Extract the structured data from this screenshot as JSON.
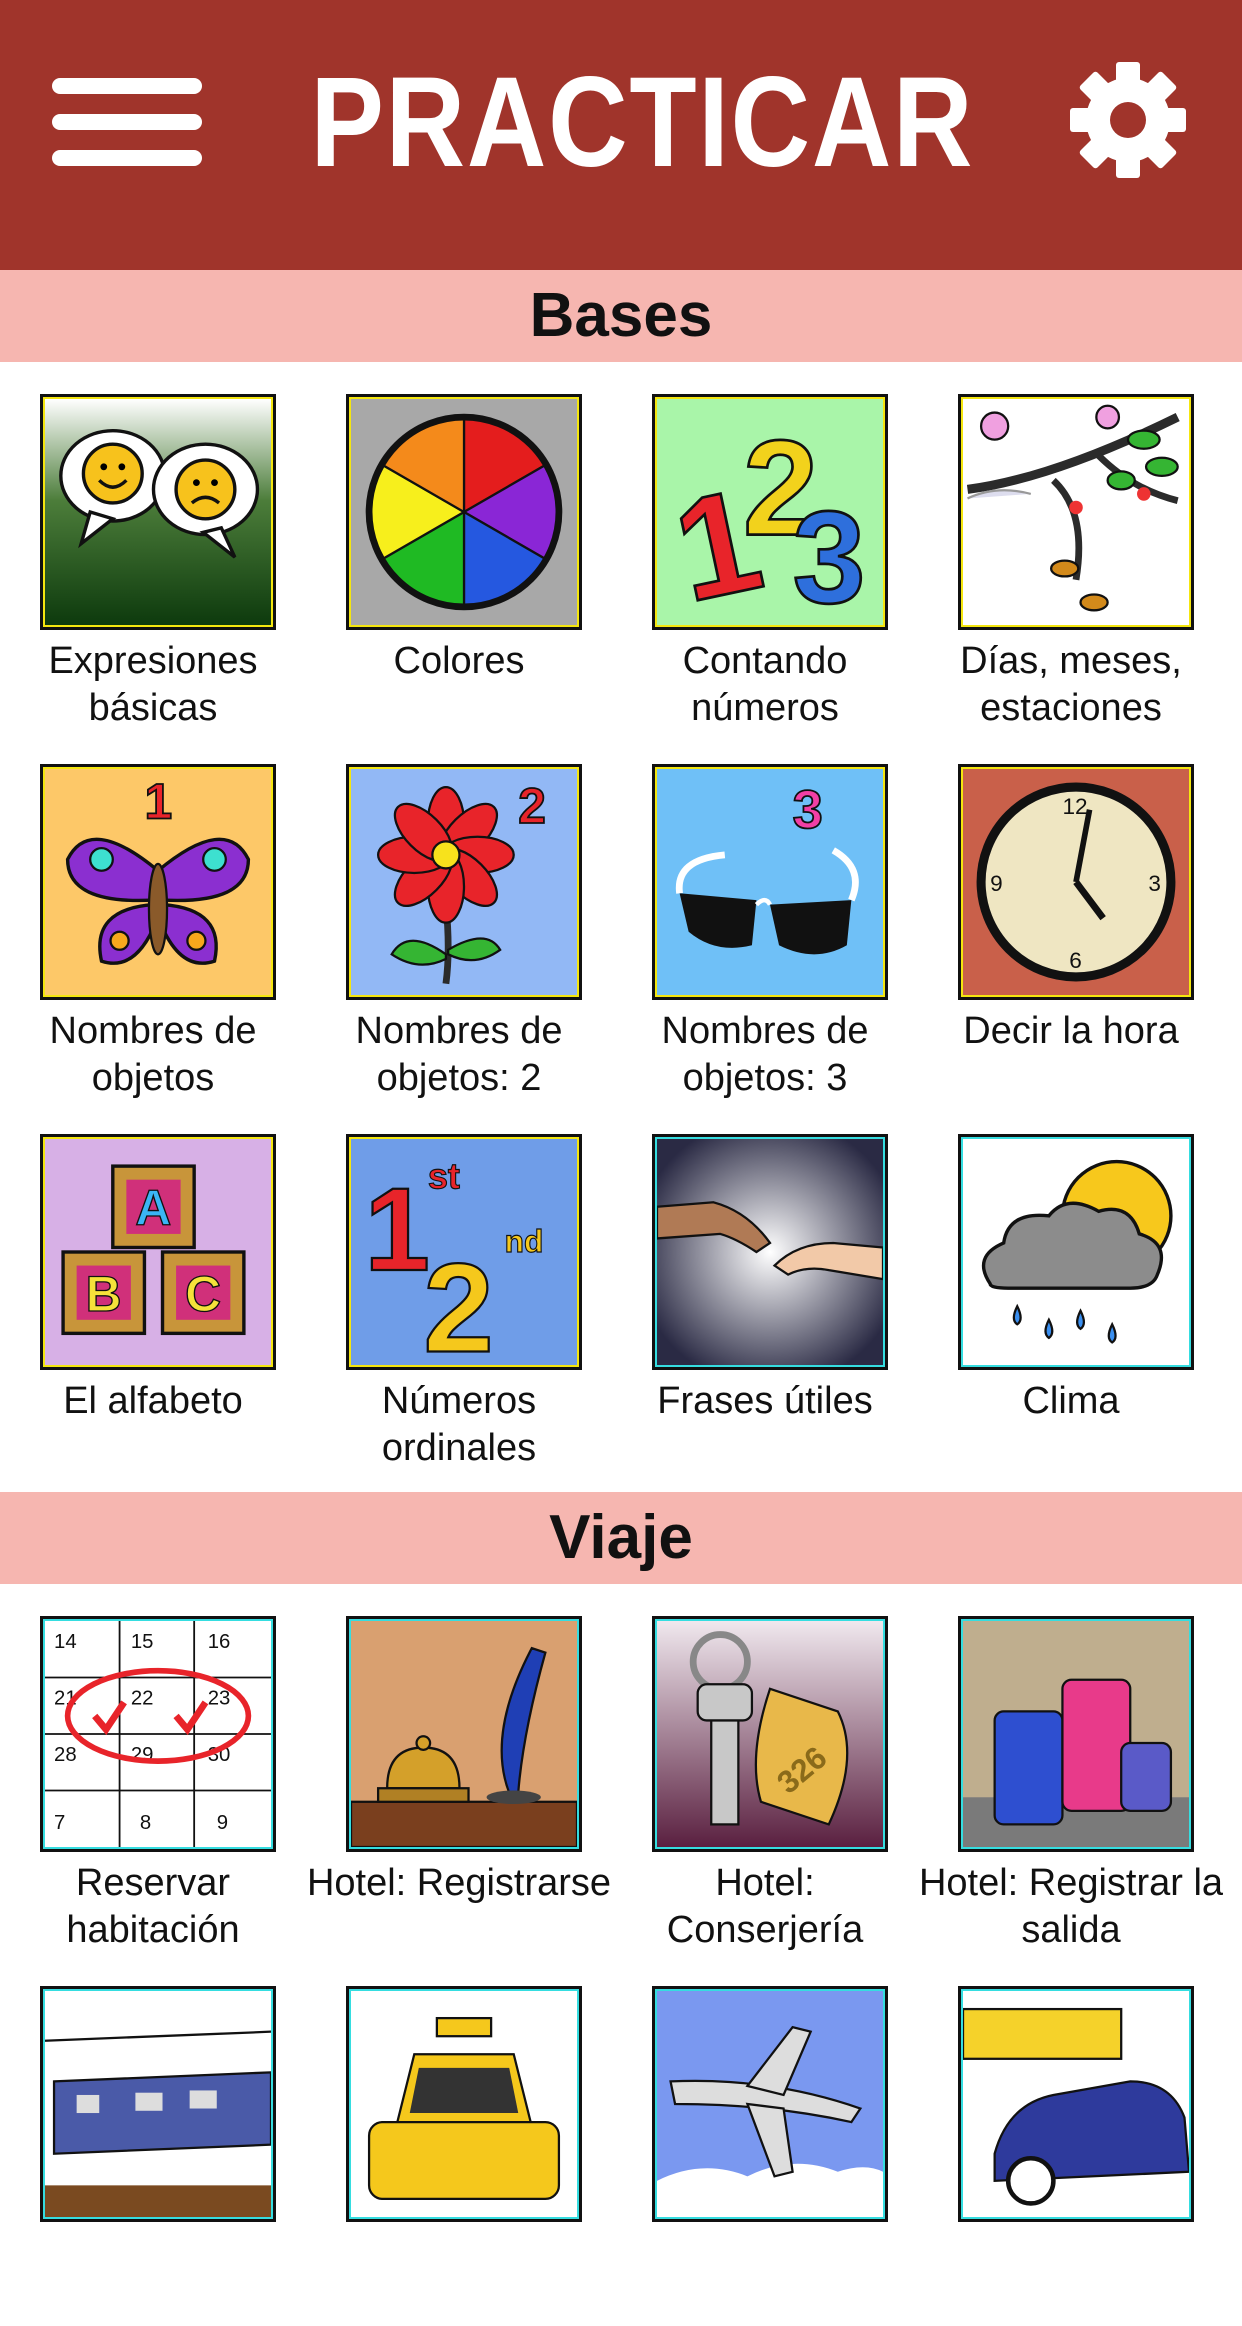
{
  "header": {
    "title": "PRACTICAR"
  },
  "sections": [
    {
      "title": "Bases",
      "items": [
        {
          "label": "Expresiones básicas",
          "icon": "smiley-speech-bubbles-icon"
        },
        {
          "label": "Colores",
          "icon": "color-wheel-icon"
        },
        {
          "label": "Contando números",
          "icon": "numbers-123-icon"
        },
        {
          "label": "Días, meses, estaciones",
          "icon": "seasons-branch-icon"
        },
        {
          "label": "Nombres de objetos",
          "icon": "butterfly-icon"
        },
        {
          "label": "Nombres de objetos: 2",
          "icon": "flower-icon"
        },
        {
          "label": "Nombres de objetos: 3",
          "icon": "sunglasses-icon"
        },
        {
          "label": "Decir la hora",
          "icon": "clock-icon"
        },
        {
          "label": "El alfabeto",
          "icon": "abc-blocks-icon"
        },
        {
          "label": "Números ordinales",
          "icon": "ordinal-numbers-icon"
        },
        {
          "label": "Frases útiles",
          "icon": "handshake-icon"
        },
        {
          "label": "Clima",
          "icon": "weather-cloud-icon"
        }
      ]
    },
    {
      "title": "Viaje",
      "items": [
        {
          "label": "Reservar habitación",
          "icon": "calendar-icon"
        },
        {
          "label": "Hotel: Registrarse",
          "icon": "reception-bell-icon"
        },
        {
          "label": "Hotel: Conserjería",
          "icon": "room-key-icon"
        },
        {
          "label": "Hotel: Registrar la salida",
          "icon": "luggage-icon"
        },
        {
          "label": "",
          "icon": "train-icon"
        },
        {
          "label": "",
          "icon": "taxi-icon"
        },
        {
          "label": "",
          "icon": "airplane-icon"
        },
        {
          "label": "",
          "icon": "rental-car-icon"
        }
      ]
    }
  ],
  "colors": {
    "header_bg": "#a0342b",
    "section_bg": "#f6b6b0",
    "frame_yellow": "#f4e60f",
    "frame_cyan": "#35dde0"
  }
}
